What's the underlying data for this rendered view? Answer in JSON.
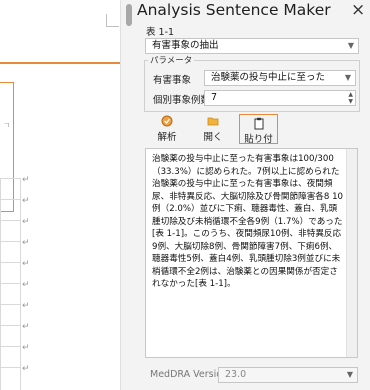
{
  "pane": {
    "title": "Analysis Sentence Maker",
    "close_label": "×",
    "table_label": "表 1-1",
    "category_select": "有害事象の抽出",
    "parameter_group": "パラメータ",
    "event_label": "有害事象",
    "event_value": "治験薬の投与中止に至った",
    "count_label": "個別事象例数",
    "count_value": "7",
    "buttons": {
      "analyze": "解析",
      "open": "開く",
      "paste": "貼り付け"
    },
    "output_text": "治験薬の投与中止に至った有害事象は100/300（33.3%）に認められた。7例以上に認められた治験薬の投与中止に至った有害事象は、夜間頻尿、非特異反応、大脳切除及び骨関節障害各8 10例（2.0%）並びに下痢、聴器毒性、蓋白、乳頭腫切除及び未梢循環不全各9例（1.7%）であった[表 1-1]。このうち、夜間頻尿10例、非特異反応9例、大脳切除8例、骨関節障害7例、下痢6例、聴器毒性5例、蓋白4例、乳頭腫切除3例並びに未梢循環不全2例は、治験薬との因果関係が否定されなかった[表 1-1]。",
    "meddra_label": "MedDRA Version",
    "meddra_value": "23.0"
  },
  "document": {
    "return_marks": [
      "↵",
      "↵",
      "↵",
      "↵",
      "↵",
      "↵",
      "↵",
      "↵",
      "↵",
      "↵",
      "↵",
      "↵",
      "↵"
    ]
  },
  "colors": {
    "accent_orange": "#e8893b",
    "pane_bg": "#f3f3f3"
  },
  "icons": [
    "chevron-down-icon",
    "analyze-icon",
    "folder-open-icon",
    "clipboard-paste-icon"
  ]
}
